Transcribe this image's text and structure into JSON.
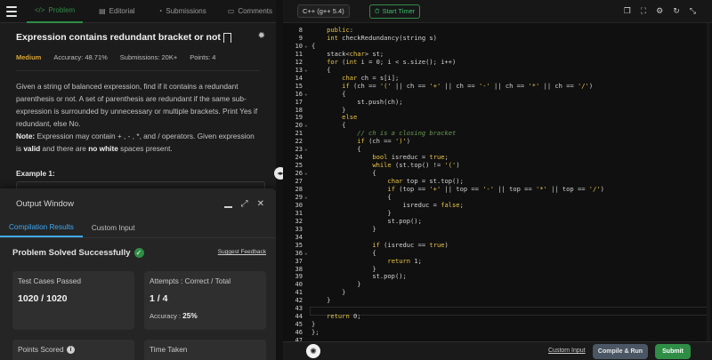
{
  "left": {
    "tabs": [
      {
        "label": "Problem",
        "icon": "code-icon"
      },
      {
        "label": "Editorial",
        "icon": "document-icon"
      },
      {
        "label": "Submissions",
        "icon": "history-icon"
      },
      {
        "label": "Comments",
        "icon": "comment-icon"
      }
    ],
    "problem": {
      "title": "Expression contains redundant bracket or not",
      "difficulty": "Medium",
      "accuracy": "Accuracy: 48.71%",
      "submissions": "Submissions: 20K+",
      "points": "Points: 4",
      "desc1": "Given a string of balanced expression, find if it contains a redundant parenthesis or not. A set of parenthesis are redundant if the same sub-expression is surrounded by unnecessary or multiple brackets. Print Yes if redundant, else No.",
      "note_label": "Note:",
      "note_text": " Expression may contain + , - , *, and / operators. Given expression is ",
      "valid": "valid",
      "note_mid": " and there are ",
      "no_white": "no white",
      "note_end": " spaces present.",
      "example_label": "Example 1:"
    }
  },
  "output": {
    "title": "Output Window",
    "tabs": [
      "Compilation Results",
      "Custom Input"
    ],
    "status": "Problem Solved Successfully",
    "feedback": "Suggest Feedback",
    "cards": {
      "tests_label": "Test Cases Passed",
      "tests_value": "1020 / 1020",
      "attempts_label": "Attempts : Correct / Total",
      "attempts_value": "1 / 4",
      "accuracy_label": "Accuracy :",
      "accuracy_value": "25%",
      "points_label": "Points Scored",
      "time_label": "Time Taken"
    }
  },
  "editor": {
    "language": "C++ (g++ 5.4)",
    "timer_label": "Start Timer",
    "lines": [
      {
        "n": "8",
        "code": "    public:"
      },
      {
        "n": "9",
        "code": "    int checkRedundancy(string s)"
      },
      {
        "n": "10",
        "code": "{"
      },
      {
        "n": "11",
        "code": "    stack<char> st;"
      },
      {
        "n": "12",
        "code": "    for (int i = 0; i < s.size(); i++)"
      },
      {
        "n": "13",
        "code": "    {"
      },
      {
        "n": "14",
        "code": "        char ch = s[i];"
      },
      {
        "n": "15",
        "code": "        if (ch == '(' || ch == '+' || ch == '-' || ch == '*' || ch == '/')"
      },
      {
        "n": "16",
        "code": "        {"
      },
      {
        "n": "17",
        "code": "            st.push(ch);"
      },
      {
        "n": "18",
        "code": "        }"
      },
      {
        "n": "19",
        "code": "        else"
      },
      {
        "n": "20",
        "code": "        {"
      },
      {
        "n": "21",
        "code": "            // ch is a closing bracket"
      },
      {
        "n": "22",
        "code": "            if (ch == ')')"
      },
      {
        "n": "23",
        "code": "            {"
      },
      {
        "n": "24",
        "code": "                bool isreduc = true;"
      },
      {
        "n": "25",
        "code": "                while (st.top() != '(')"
      },
      {
        "n": "26",
        "code": "                {"
      },
      {
        "n": "27",
        "code": "                    char top = st.top();"
      },
      {
        "n": "28",
        "code": "                    if (top == '+' || top == '-' || top == '*' || top == '/')"
      },
      {
        "n": "29",
        "code": "                    {"
      },
      {
        "n": "30",
        "code": "                        isreduc = false;"
      },
      {
        "n": "31",
        "code": "                    }"
      },
      {
        "n": "32",
        "code": "                    st.pop();"
      },
      {
        "n": "33",
        "code": "                }"
      },
      {
        "n": "34",
        "code": ""
      },
      {
        "n": "35",
        "code": "                if (isreduc == true)"
      },
      {
        "n": "36",
        "code": "                {"
      },
      {
        "n": "37",
        "code": "                    return 1;"
      },
      {
        "n": "38",
        "code": "                }"
      },
      {
        "n": "39",
        "code": "                st.pop();"
      },
      {
        "n": "40",
        "code": "            }"
      },
      {
        "n": "41",
        "code": "        }"
      },
      {
        "n": "42",
        "code": "    }"
      },
      {
        "n": "43",
        "code": ""
      },
      {
        "n": "44",
        "code": "    return 0;"
      },
      {
        "n": "45",
        "code": "}"
      },
      {
        "n": "46",
        "code": "};"
      },
      {
        "n": "47",
        "code": ""
      }
    ],
    "custom_input": "Custom Input",
    "compile_run": "Compile & Run",
    "submit": "Submit"
  }
}
